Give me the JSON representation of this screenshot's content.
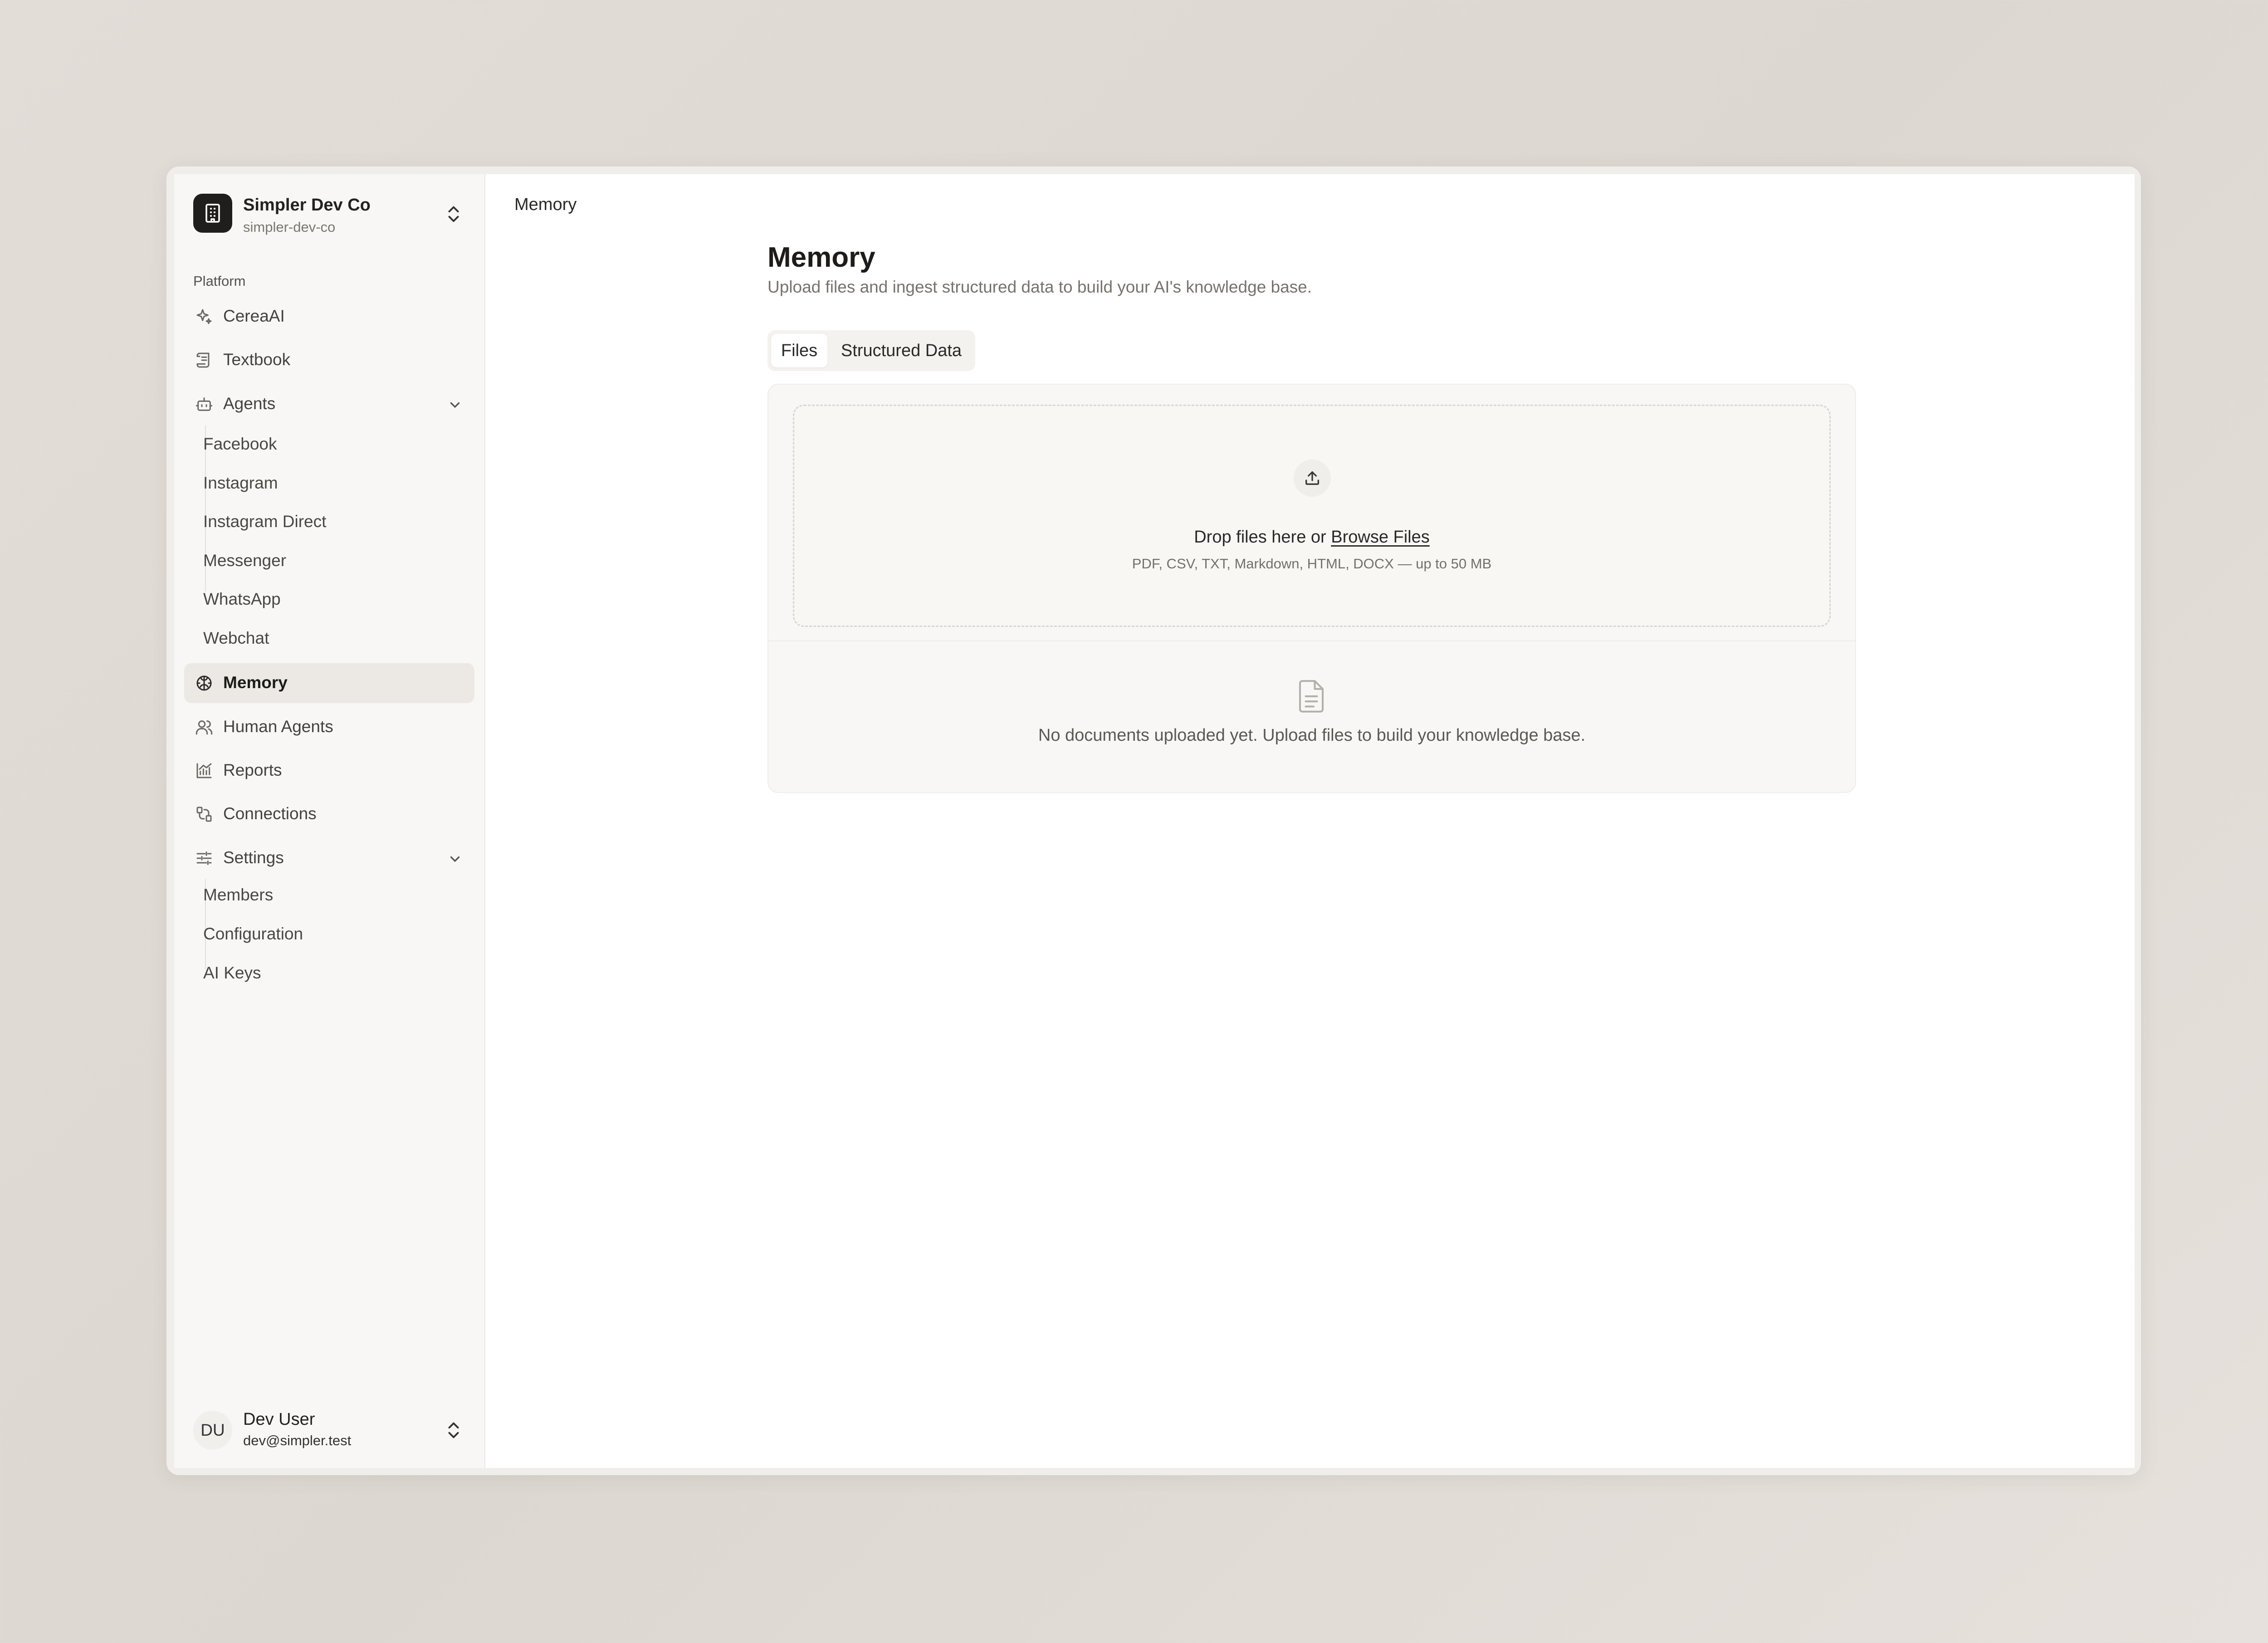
{
  "org": {
    "name": "Simpler Dev Co",
    "slug": "simpler-dev-co"
  },
  "sidebar": {
    "section_label": "Platform",
    "items": {
      "cereai": "CereaAI",
      "textbook": "Textbook",
      "agents": "Agents",
      "memory": "Memory",
      "human_agents": "Human Agents",
      "reports": "Reports",
      "connections": "Connections",
      "settings": "Settings"
    },
    "agents_sub": [
      "Facebook",
      "Instagram",
      "Instagram Direct",
      "Messenger",
      "WhatsApp",
      "Webchat"
    ],
    "settings_sub": [
      "Members",
      "Configuration",
      "AI Keys"
    ]
  },
  "user": {
    "initials": "DU",
    "name": "Dev User",
    "email": "dev@simpler.test"
  },
  "main": {
    "breadcrumb": "Memory",
    "title": "Memory",
    "subtitle": "Upload files and ingest structured data to build your AI's knowledge base.",
    "tabs": {
      "files": "Files",
      "structured": "Structured Data"
    },
    "dropzone": {
      "text_prefix": "Drop files here or ",
      "browse_label": "Browse Files",
      "hint": "PDF, CSV, TXT, Markdown, HTML, DOCX — up to 50 MB"
    },
    "empty_state": "No documents uploaded yet. Upload files to build your knowledge base."
  }
}
